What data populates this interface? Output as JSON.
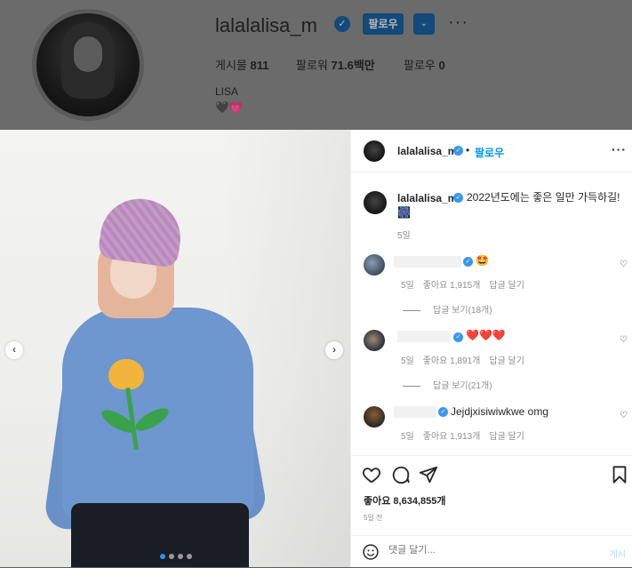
{
  "profile": {
    "username": "lalalalisa_m",
    "follow_label": "팔로우",
    "posts_label": "게시물",
    "posts_count": "811",
    "followers_label": "팔로워",
    "followers_count": "71.6백만",
    "following_label": "팔로우",
    "following_count": "0",
    "bio_name": "LISA",
    "bio_emoji": "🖤💗"
  },
  "post": {
    "author": "lalalalisa_m",
    "follow_label": "팔로우",
    "caption": "2022년도에는 좋은 일만 가득하길!",
    "caption_emoji": "🎆",
    "caption_time": "5일",
    "comments": [
      {
        "emoji": "🤩",
        "time": "5일",
        "likes": "좋아요 1,915개",
        "reply": "답글 달기",
        "view_replies": "답글 보기(18개)"
      },
      {
        "emoji": "❤️❤️❤️",
        "time": "5일",
        "likes": "좋아요 1,891개",
        "reply": "답글 달기",
        "view_replies": "답글 보기(21개)"
      },
      {
        "text": "Jejdjxisiwiwkwe omg",
        "time": "5일",
        "likes": "좋아요 1,913개",
        "reply": "답글 달기"
      }
    ],
    "likes_total": "좋아요 8,634,855개",
    "time_ago": "5일 전",
    "comment_placeholder": "댓글 달기...",
    "post_button": "게시"
  },
  "icons": {
    "verified": "verified-badge-icon",
    "more": "more-options-icon",
    "heart": "heart-icon",
    "comment": "comment-icon",
    "share": "share-icon",
    "save": "bookmark-icon",
    "emoji": "emoji-icon",
    "prev": "chevron-left-icon",
    "next": "chevron-right-icon"
  },
  "colors": {
    "accent": "#0095f6",
    "verified": "#3897f0",
    "sweater": "#6e96cf"
  }
}
